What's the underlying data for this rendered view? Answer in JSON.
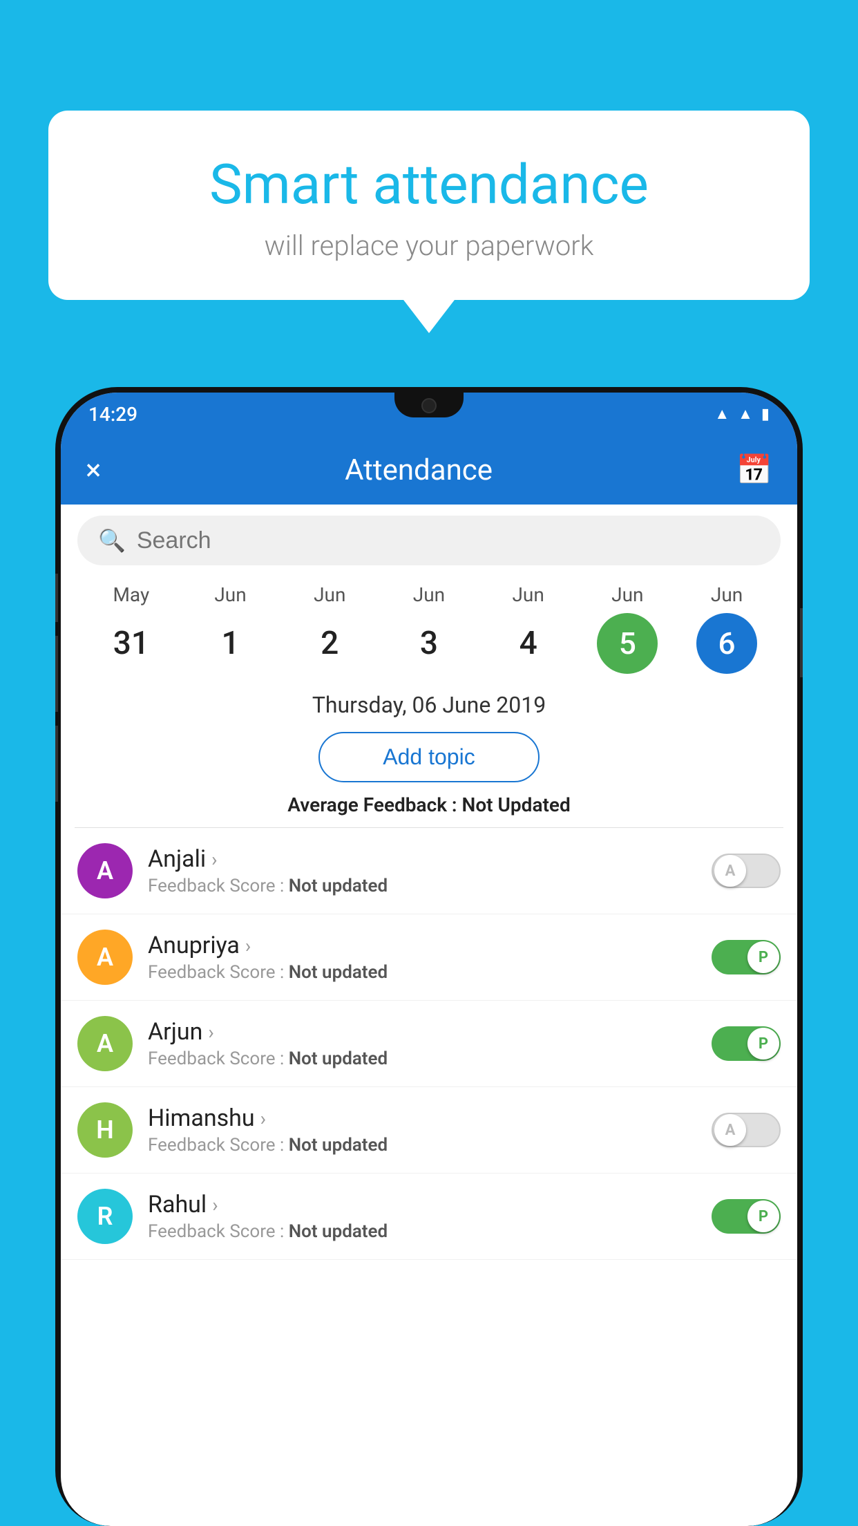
{
  "background_color": "#1ab8e8",
  "bubble": {
    "title": "Smart attendance",
    "subtitle": "will replace your paperwork"
  },
  "status_bar": {
    "time": "14:29",
    "icons": [
      "wifi",
      "signal",
      "battery"
    ]
  },
  "app_bar": {
    "title": "Attendance",
    "close_label": "×",
    "calendar_label": "📅"
  },
  "search": {
    "placeholder": "Search"
  },
  "calendar": {
    "months": [
      "May",
      "Jun",
      "Jun",
      "Jun",
      "Jun",
      "Jun",
      "Jun"
    ],
    "dates": [
      "31",
      "1",
      "2",
      "3",
      "4",
      "5",
      "6"
    ],
    "today_index": 5,
    "selected_index": 6
  },
  "selected_date_label": "Thursday, 06 June 2019",
  "add_topic_label": "Add topic",
  "avg_feedback_label": "Average Feedback :",
  "avg_feedback_value": "Not Updated",
  "students": [
    {
      "name": "Anjali",
      "avatar_letter": "A",
      "avatar_color": "#9c27b0",
      "score_label": "Feedback Score :",
      "score_value": "Not updated",
      "toggle": "off",
      "toggle_letter": "A"
    },
    {
      "name": "Anupriya",
      "avatar_letter": "A",
      "avatar_color": "#ffa726",
      "score_label": "Feedback Score :",
      "score_value": "Not updated",
      "toggle": "on",
      "toggle_letter": "P"
    },
    {
      "name": "Arjun",
      "avatar_letter": "A",
      "avatar_color": "#8bc34a",
      "score_label": "Feedback Score :",
      "score_value": "Not updated",
      "toggle": "on",
      "toggle_letter": "P"
    },
    {
      "name": "Himanshu",
      "avatar_letter": "H",
      "avatar_color": "#8bc34a",
      "score_label": "Feedback Score :",
      "score_value": "Not updated",
      "toggle": "off",
      "toggle_letter": "A"
    },
    {
      "name": "Rahul",
      "avatar_letter": "R",
      "avatar_color": "#26c6da",
      "score_label": "Feedback Score :",
      "score_value": "Not updated",
      "toggle": "on",
      "toggle_letter": "P"
    }
  ]
}
